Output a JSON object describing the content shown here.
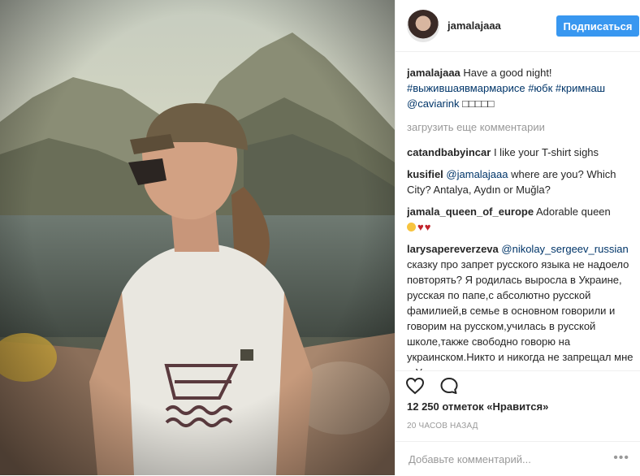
{
  "post": {
    "username": "jamalajaaa",
    "follow_label": "Подписаться"
  },
  "caption": {
    "user": "jamalajaaa",
    "text": "Have a good night!",
    "hashtags": "#выжившаявмармарисе #юбк #кримнаш",
    "mention": "@caviarink",
    "trailing": "□□□□□"
  },
  "load_more_label": "загрузить еще комментарии",
  "comments": [
    {
      "user": "catandbabyincar",
      "mention": "",
      "text": "I like your T-shirt sighs",
      "emoji": ""
    },
    {
      "user": "kusifiel",
      "mention": "@jamalajaaa",
      "text": "where are you? Which City? Antalya, Aydın or Muğla?",
      "emoji": ""
    },
    {
      "user": "jamala_queen_of_europe",
      "mention": "",
      "text": "Adorable queen",
      "emoji": "♥♥"
    },
    {
      "user": "larysapereverzeva",
      "mention": "@nikolay_sergeev_russian",
      "text": "сказку про запрет русского языка не надоело повторять? Я родилась выросла в Украине, русская по папе,с абсолютно русской фамилией,в семье в основном говорили и говорим на русском,училась в русской школе,также свободно говорю на украинском.Никто и никогда не запрещал мне в Украине разговаривать, учить, писать",
      "emoji": ""
    }
  ],
  "likes_text": "12 250 отметок «Нравится»",
  "time_text": "20 ЧАСОВ НАЗАД",
  "add_comment_placeholder": "Добавьте комментарий...",
  "more_label": "•••",
  "icons": {
    "like": "heart-outline-icon",
    "comment": "speech-bubble-icon",
    "more": "more-dots-icon"
  },
  "colors": {
    "accent": "#3897f0",
    "link": "#003569",
    "muted": "#999999",
    "text": "#262626"
  }
}
